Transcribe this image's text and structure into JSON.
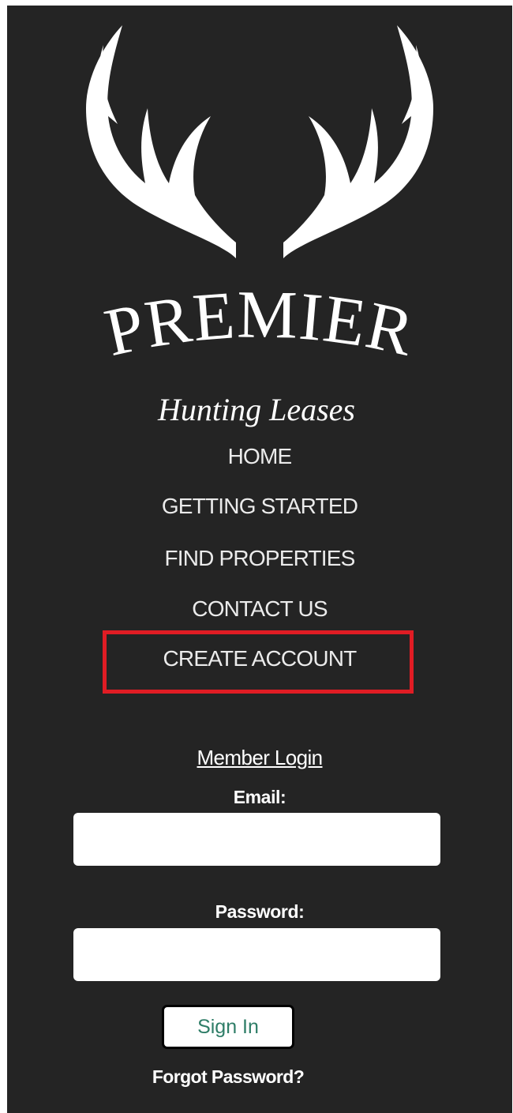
{
  "brand": {
    "logo_icon": "antlers-icon",
    "name": "PREMIER",
    "tagline": "Hunting Leases"
  },
  "nav": {
    "items": [
      {
        "label": "HOME"
      },
      {
        "label": "GETTING STARTED"
      },
      {
        "label": "FIND PROPERTIES"
      },
      {
        "label": "CONTACT US"
      },
      {
        "label": "CREATE ACCOUNT"
      }
    ]
  },
  "login": {
    "title": "Member Login",
    "email_label": "Email:",
    "email_value": "",
    "password_label": "Password:",
    "password_value": "",
    "sign_in_label": "Sign In",
    "forgot_label": "Forgot Password?"
  },
  "colors": {
    "background": "#242424",
    "text": "#ebebeb",
    "highlight": "#e01c24",
    "button_text": "#2e7d67"
  }
}
